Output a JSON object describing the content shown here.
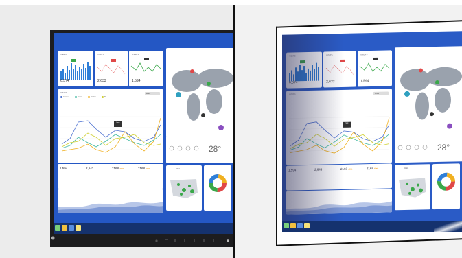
{
  "kpis": [
    {
      "label": "VIEWS",
      "value": "6,574",
      "color": "#2f7fd8"
    },
    {
      "label": "VISITS",
      "value": "2,633",
      "color": "#e04848"
    },
    {
      "label": "USERS",
      "value": "1,594",
      "color": "#3aa84a"
    }
  ],
  "main_chart": {
    "title": "VISITS",
    "filter": "Week",
    "legend": [
      "Chrome",
      "Safari",
      "Firefox",
      "IE"
    ],
    "colors": [
      "#4a6fd0",
      "#3cb8a0",
      "#f0b020",
      "#cfcf30"
    ],
    "tooltip": "Peak"
  },
  "stats": [
    {
      "value": "1,594",
      "tag": ""
    },
    {
      "value": "2,643",
      "tag": ""
    },
    {
      "value": "2168",
      "tag": "40%"
    },
    {
      "value": "2168",
      "tag": "50%"
    }
  ],
  "weather": {
    "temperature": "28°"
  },
  "us_map": {
    "title": "USA"
  },
  "colors": {
    "screen": "#2457c4",
    "taskbar": "#15326e",
    "card": "#ffffff"
  }
}
